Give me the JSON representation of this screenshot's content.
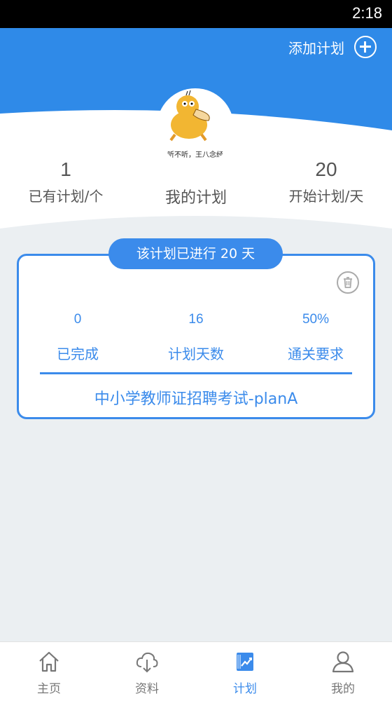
{
  "status_bar": {
    "time": "2:18"
  },
  "header": {
    "add_plan_label": "添加计划",
    "avatar_caption": "听不听，王八念经",
    "stats": {
      "plans_count": "1",
      "plans_label": "已有计划/个",
      "center_label": "我的计划",
      "days_value": "20",
      "days_label": "开始计划/天"
    }
  },
  "plan_card": {
    "progress_text": "该计划已进行  20  天",
    "columns": [
      {
        "value": "0",
        "label": "已完成"
      },
      {
        "value": "16",
        "label": "计划天数"
      },
      {
        "value": "50%",
        "label": "通关要求"
      }
    ],
    "plan_name": "中小学教师证招聘考试-planA"
  },
  "tabbar": {
    "tabs": [
      {
        "label": "主页",
        "icon": "home-icon",
        "active": false
      },
      {
        "label": "资料",
        "icon": "cloud-download-icon",
        "active": false
      },
      {
        "label": "计划",
        "icon": "plan-chart-icon",
        "active": true
      },
      {
        "label": "我的",
        "icon": "user-icon",
        "active": false
      }
    ]
  },
  "colors": {
    "brand_blue": "#3b8beb",
    "background": "#ebeff2"
  }
}
